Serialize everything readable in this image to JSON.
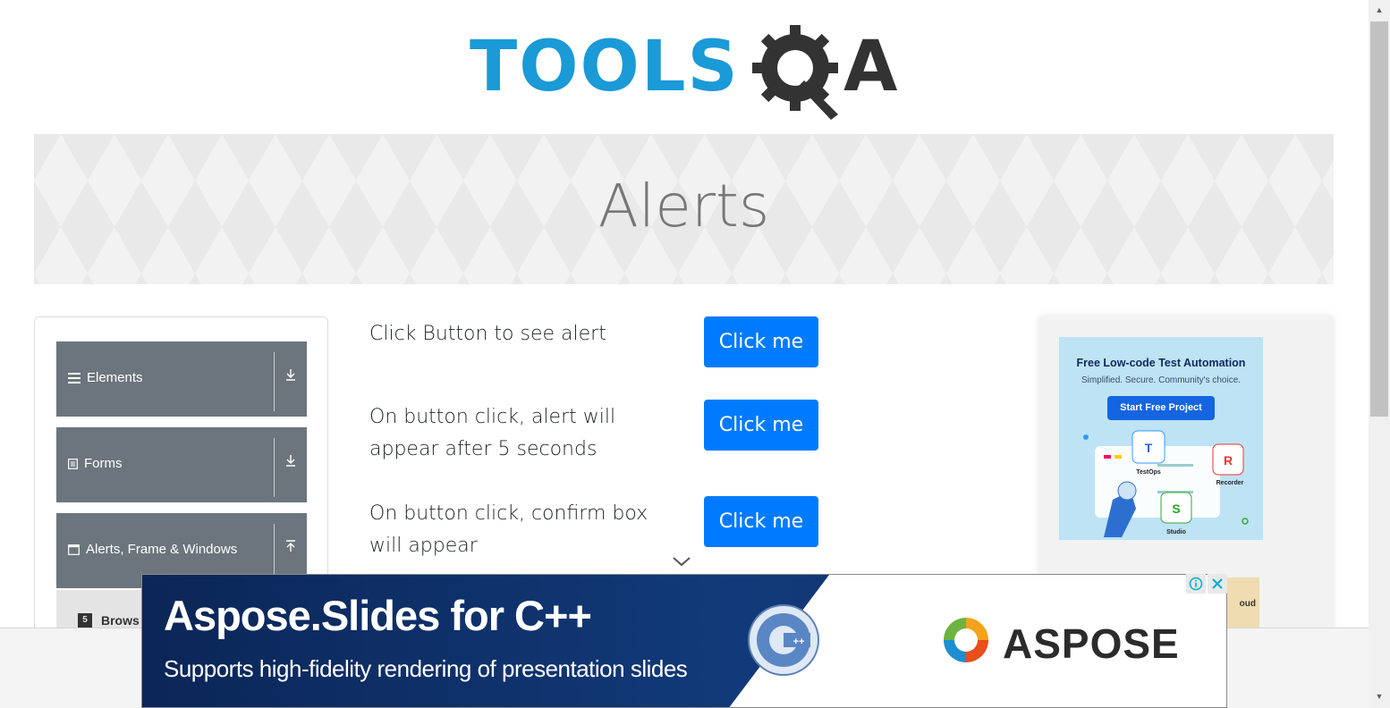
{
  "logo": {
    "text_left": "TOOLS",
    "text_right": "A",
    "name": "ToolsQA"
  },
  "banner": {
    "title": "Alerts"
  },
  "sidebar": {
    "groups": [
      {
        "label": "Elements",
        "icon": "hamburger-icon",
        "toggle": "↓"
      },
      {
        "label": "Forms",
        "icon": "list-icon",
        "toggle": "↓"
      },
      {
        "label": "Alerts, Frame & Windows",
        "icon": "window-icon",
        "toggle": "↑"
      }
    ],
    "active_sub_item": {
      "label": "Browser Windows",
      "visible_label": "Brows",
      "icon": "html5-icon"
    }
  },
  "main": {
    "rows": [
      {
        "text": "Click Button to see alert",
        "button": "Click me"
      },
      {
        "text": "On button click, alert will appear after 5 seconds",
        "button": "Click me"
      },
      {
        "text": "On button click, confirm box will appear",
        "button": "Click me"
      }
    ]
  },
  "ad_right": {
    "title": "Free Low-code Test Automation",
    "subtitle": "Simplified. Secure. Community's choice.",
    "cta": "Start Free Project",
    "products": [
      "TestOps",
      "Recorder",
      "Studio"
    ],
    "partial_label": "oud"
  },
  "ad_bottom": {
    "headline": "Aspose.Slides for C++",
    "subtext": "Supports high-fidelity rendering of presentation slides",
    "brand": "ASPOSE",
    "badge": "C++"
  },
  "colors": {
    "primary": "#007bff",
    "sidebar": "#6c757d",
    "logo_blue": "#1a9ad6",
    "ad_navy": "#0b2657"
  }
}
